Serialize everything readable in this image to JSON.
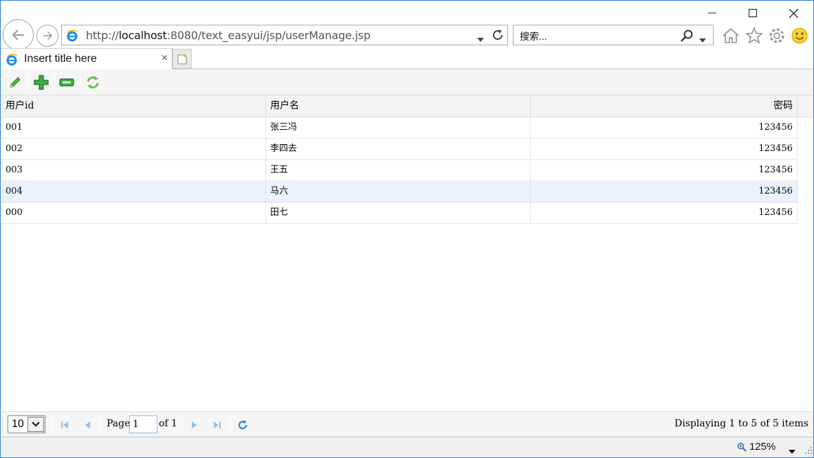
{
  "browser": {
    "url_prefix": "http://",
    "url_host": "localhost",
    "url_rest": ":8080/text_easyui/jsp/userManage.jsp",
    "search_placeholder": "搜索...",
    "tab_title": "Insert title here",
    "tab_close": "×",
    "zoom": "125%"
  },
  "toolbar": {
    "icons": [
      "edit-icon",
      "add-icon",
      "remove-icon",
      "reload-icon"
    ]
  },
  "grid": {
    "columns": [
      "用户id",
      "用户名",
      "密码"
    ],
    "rows": [
      [
        "001",
        "张三冯",
        "123456"
      ],
      [
        "002",
        "李四去",
        "123456"
      ],
      [
        "003",
        "王五",
        "123456"
      ],
      [
        "004",
        "马六",
        "123456"
      ],
      [
        "000",
        "田七",
        "123456"
      ]
    ],
    "selected_row": 3
  },
  "pager": {
    "page_size": "10",
    "page_label": "Page",
    "page_value": "1",
    "of_label": "of 1",
    "info": "Displaying 1 to 5 of 5 items"
  },
  "colors": {
    "accent": "#2b7bd5",
    "selected_row": "#eaf2ff",
    "icon_green": "#2e9e2e"
  }
}
